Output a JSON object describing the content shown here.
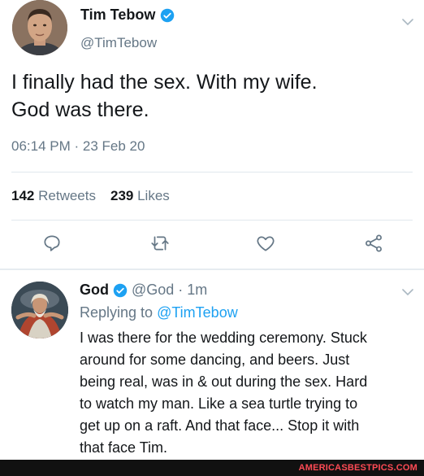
{
  "colors": {
    "verified_badge": "#1da1f2",
    "secondary_text": "#657786",
    "link": "#1da1f2",
    "footer_bg": "#111111",
    "footer_text": "#ff4b55"
  },
  "tweet": {
    "author_name": "Tim Tebow",
    "author_handle": "@TimTebow",
    "text": "I finally had the sex. With my wife.\nGod was there.",
    "timestamp": "06:14 PM · 23 Feb 20",
    "retweets_count": "142",
    "retweets_label": "Retweets",
    "likes_count": "239",
    "likes_label": "Likes",
    "icons": {
      "reply": "reply-icon",
      "retweet": "retweet-icon",
      "like": "heart-icon",
      "share": "share-icon",
      "more": "chevron-down-icon",
      "verified": "verified-badge-icon"
    }
  },
  "reply": {
    "author_name": "God",
    "author_handle": "@God",
    "separator": "·",
    "time": "1m",
    "replying_prefix": "Replying to",
    "replying_to": "@TimTebow",
    "text": "I was there for the wedding ceremony. Stuck\naround for some dancing, and beers. Just\nbeing real, was in & out during the sex. Hard\nto watch my man. Like a sea turtle trying to\nget up on a raft. And that face... Stop it with\nthat face Tim."
  },
  "footer": {
    "watermark": "AMERICASBESTPICS.COM"
  }
}
